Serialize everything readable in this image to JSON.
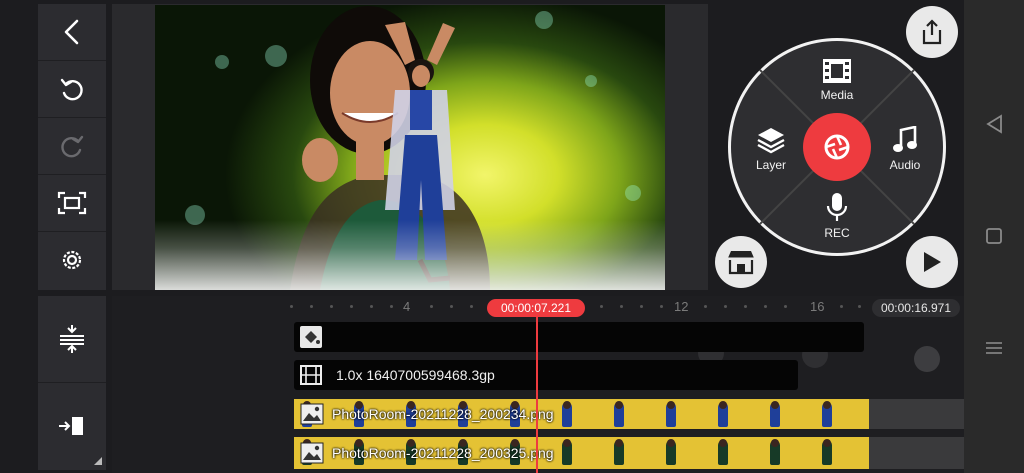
{
  "preview": {
    "description_icons": [
      "back-icon",
      "undo-icon",
      "redo-icon",
      "crop-icon",
      "settings-icon"
    ]
  },
  "wheel": {
    "media_label": "Media",
    "layer_label": "Layer",
    "audio_label": "Audio",
    "rec_label": "REC"
  },
  "timeline": {
    "current_time": "00:00:07.221",
    "total_time": "00:00:16.971",
    "ruler_marks": [
      "4",
      "12",
      "16"
    ],
    "video_clip_label": "1.0x 1640700599468.3gp",
    "layer1_label": "PhotoRoom-20211228_200234.png",
    "layer2_label": "PhotoRoom-20211228_200325.png"
  },
  "colors": {
    "accent": "#ee3b3f",
    "layer_track": "#e4c234",
    "panel": "#2c2c30"
  }
}
